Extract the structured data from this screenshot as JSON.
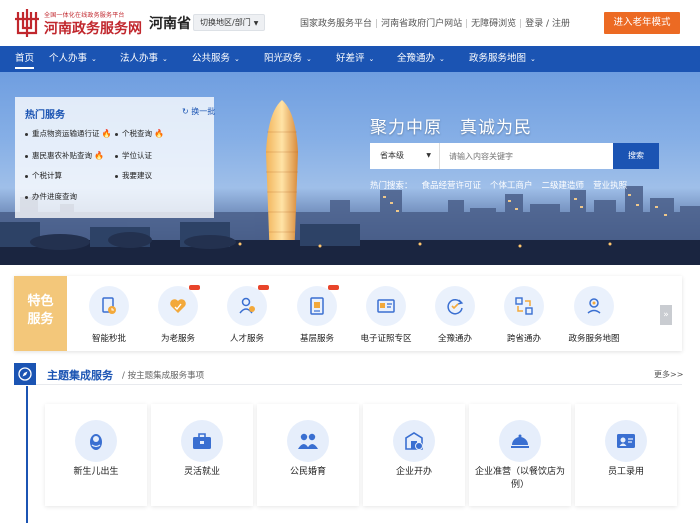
{
  "header": {
    "brand_small": "全国一体化在线政务服务平台",
    "brand_name": "河南政务服务网",
    "province": "河南省",
    "switch_label": "切换地区/部门",
    "links": [
      "国家政务服务平台",
      "河南省政府门户网站",
      "无障碍浏览",
      "登录 / 注册"
    ],
    "elder_mode": "进入老年模式"
  },
  "nav": {
    "items": [
      {
        "label": "首页",
        "has_menu": false
      },
      {
        "label": "个人办事",
        "has_menu": true
      },
      {
        "label": "法人办事",
        "has_menu": true
      },
      {
        "label": "公共服务",
        "has_menu": true
      },
      {
        "label": "阳光政务",
        "has_menu": true
      },
      {
        "label": "好差评",
        "has_menu": true
      },
      {
        "label": "全豫通办",
        "has_menu": true
      },
      {
        "label": "政务服务地图",
        "has_menu": true
      }
    ]
  },
  "hot_services": {
    "title": "热门服务",
    "refresh": "换一批",
    "items": [
      {
        "label": "重点物资运输通行证",
        "hot": true
      },
      {
        "label": "个税查询",
        "hot": true
      },
      {
        "label": "惠民惠农补贴查询",
        "hot": true
      },
      {
        "label": "学位认证",
        "hot": false
      },
      {
        "label": "个税计算",
        "hot": false
      },
      {
        "label": "我要建议",
        "hot": false
      },
      {
        "label": "办件进度查询",
        "hot": false
      }
    ]
  },
  "banner": {
    "slogan": "聚力中原　真诚为民",
    "search_scope": "省本级",
    "search_placeholder": "请输入内容关键字",
    "search_button": "搜索",
    "hot_search_label": "热门搜索：",
    "hot_search": [
      "食品经营许可证",
      "个体工商户",
      "二级建造师",
      "营业执照"
    ]
  },
  "featured": {
    "label_line1": "特色",
    "label_line2": "服务",
    "items": [
      {
        "label": "智能秒批",
        "icon": "smart-approval-icon",
        "badge": false
      },
      {
        "label": "为老服务",
        "icon": "elderly-care-icon",
        "badge": true
      },
      {
        "label": "人才服务",
        "icon": "talent-icon",
        "badge": true
      },
      {
        "label": "基层服务",
        "icon": "grassroots-icon",
        "badge": true
      },
      {
        "label": "电子证照专区",
        "icon": "e-license-icon",
        "badge": false
      },
      {
        "label": "全豫通办",
        "icon": "province-wide-icon",
        "badge": false
      },
      {
        "label": "跨省通办",
        "icon": "cross-province-icon",
        "badge": false
      },
      {
        "label": "政务服务地图",
        "icon": "map-icon",
        "badge": false
      }
    ],
    "next": "»"
  },
  "theme": {
    "title": "主题集成服务",
    "subtitle": "/ 按主题集成服务事项",
    "more": "更多>>",
    "cards": [
      {
        "label": "新生儿出生",
        "icon": "newborn-icon"
      },
      {
        "label": "灵活就业",
        "icon": "briefcase-icon"
      },
      {
        "label": "公民婚育",
        "icon": "couple-icon"
      },
      {
        "label": "企业开办",
        "icon": "enterprise-icon"
      },
      {
        "label": "企业准营（以餐饮店为例）",
        "icon": "restaurant-icon"
      },
      {
        "label": "员工录用",
        "icon": "employee-card-icon"
      }
    ]
  },
  "colors": {
    "primary": "#1b54b3",
    "brand_red": "#c1272d",
    "accent_orange": "#ec6a23",
    "featured_label": "#f3c77a"
  }
}
